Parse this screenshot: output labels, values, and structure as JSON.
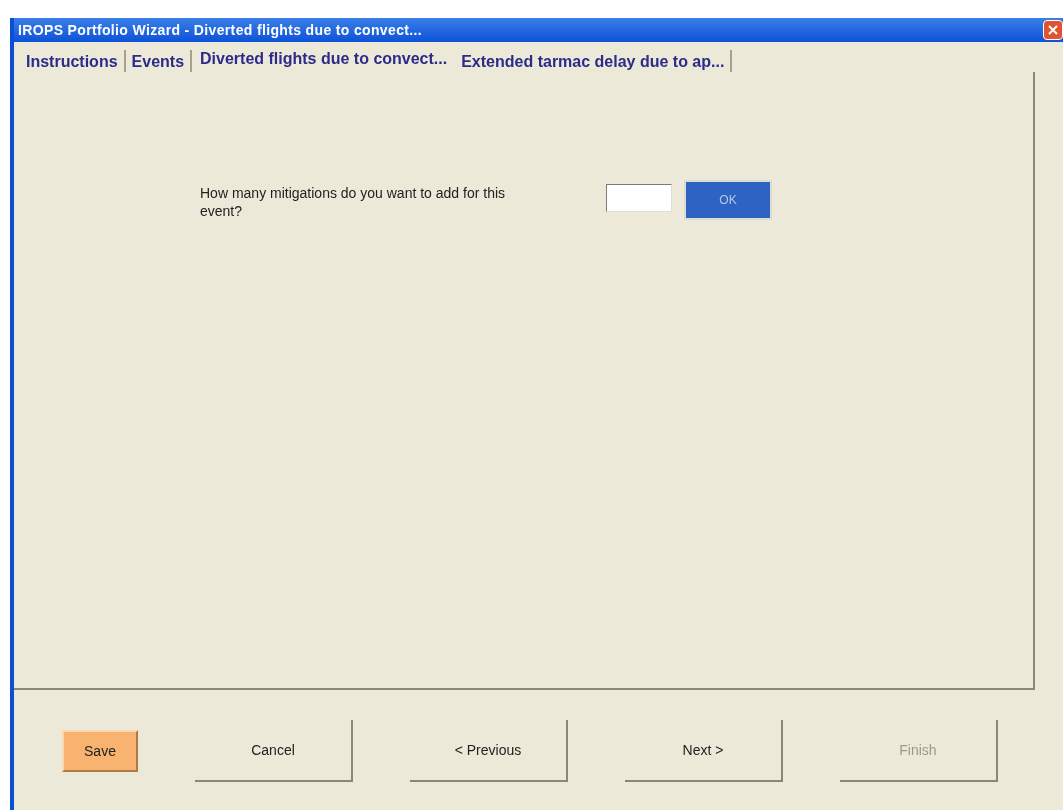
{
  "window": {
    "title": "IROPS Portfolio Wizard - Diverted flights due to convect..."
  },
  "tabs": [
    {
      "label": "Instructions",
      "selected": false
    },
    {
      "label": "Events",
      "selected": false
    },
    {
      "label": "Diverted flights due to convect...",
      "selected": true
    },
    {
      "label": "Extended tarmac delay due to ap...",
      "selected": false
    }
  ],
  "question": "How many mitigations do you want to add for this event?",
  "ok_button": "OK",
  "buttons": [
    {
      "label": "Save",
      "highlighted": true,
      "disabled": false
    },
    {
      "label": "Cancel",
      "highlighted": false,
      "disabled": false
    },
    {
      "label": "< Previous",
      "highlighted": false,
      "disabled": false
    },
    {
      "label": "Next >",
      "highlighted": false,
      "disabled": false
    },
    {
      "label": "Finish",
      "highlighted": false,
      "disabled": true
    }
  ]
}
